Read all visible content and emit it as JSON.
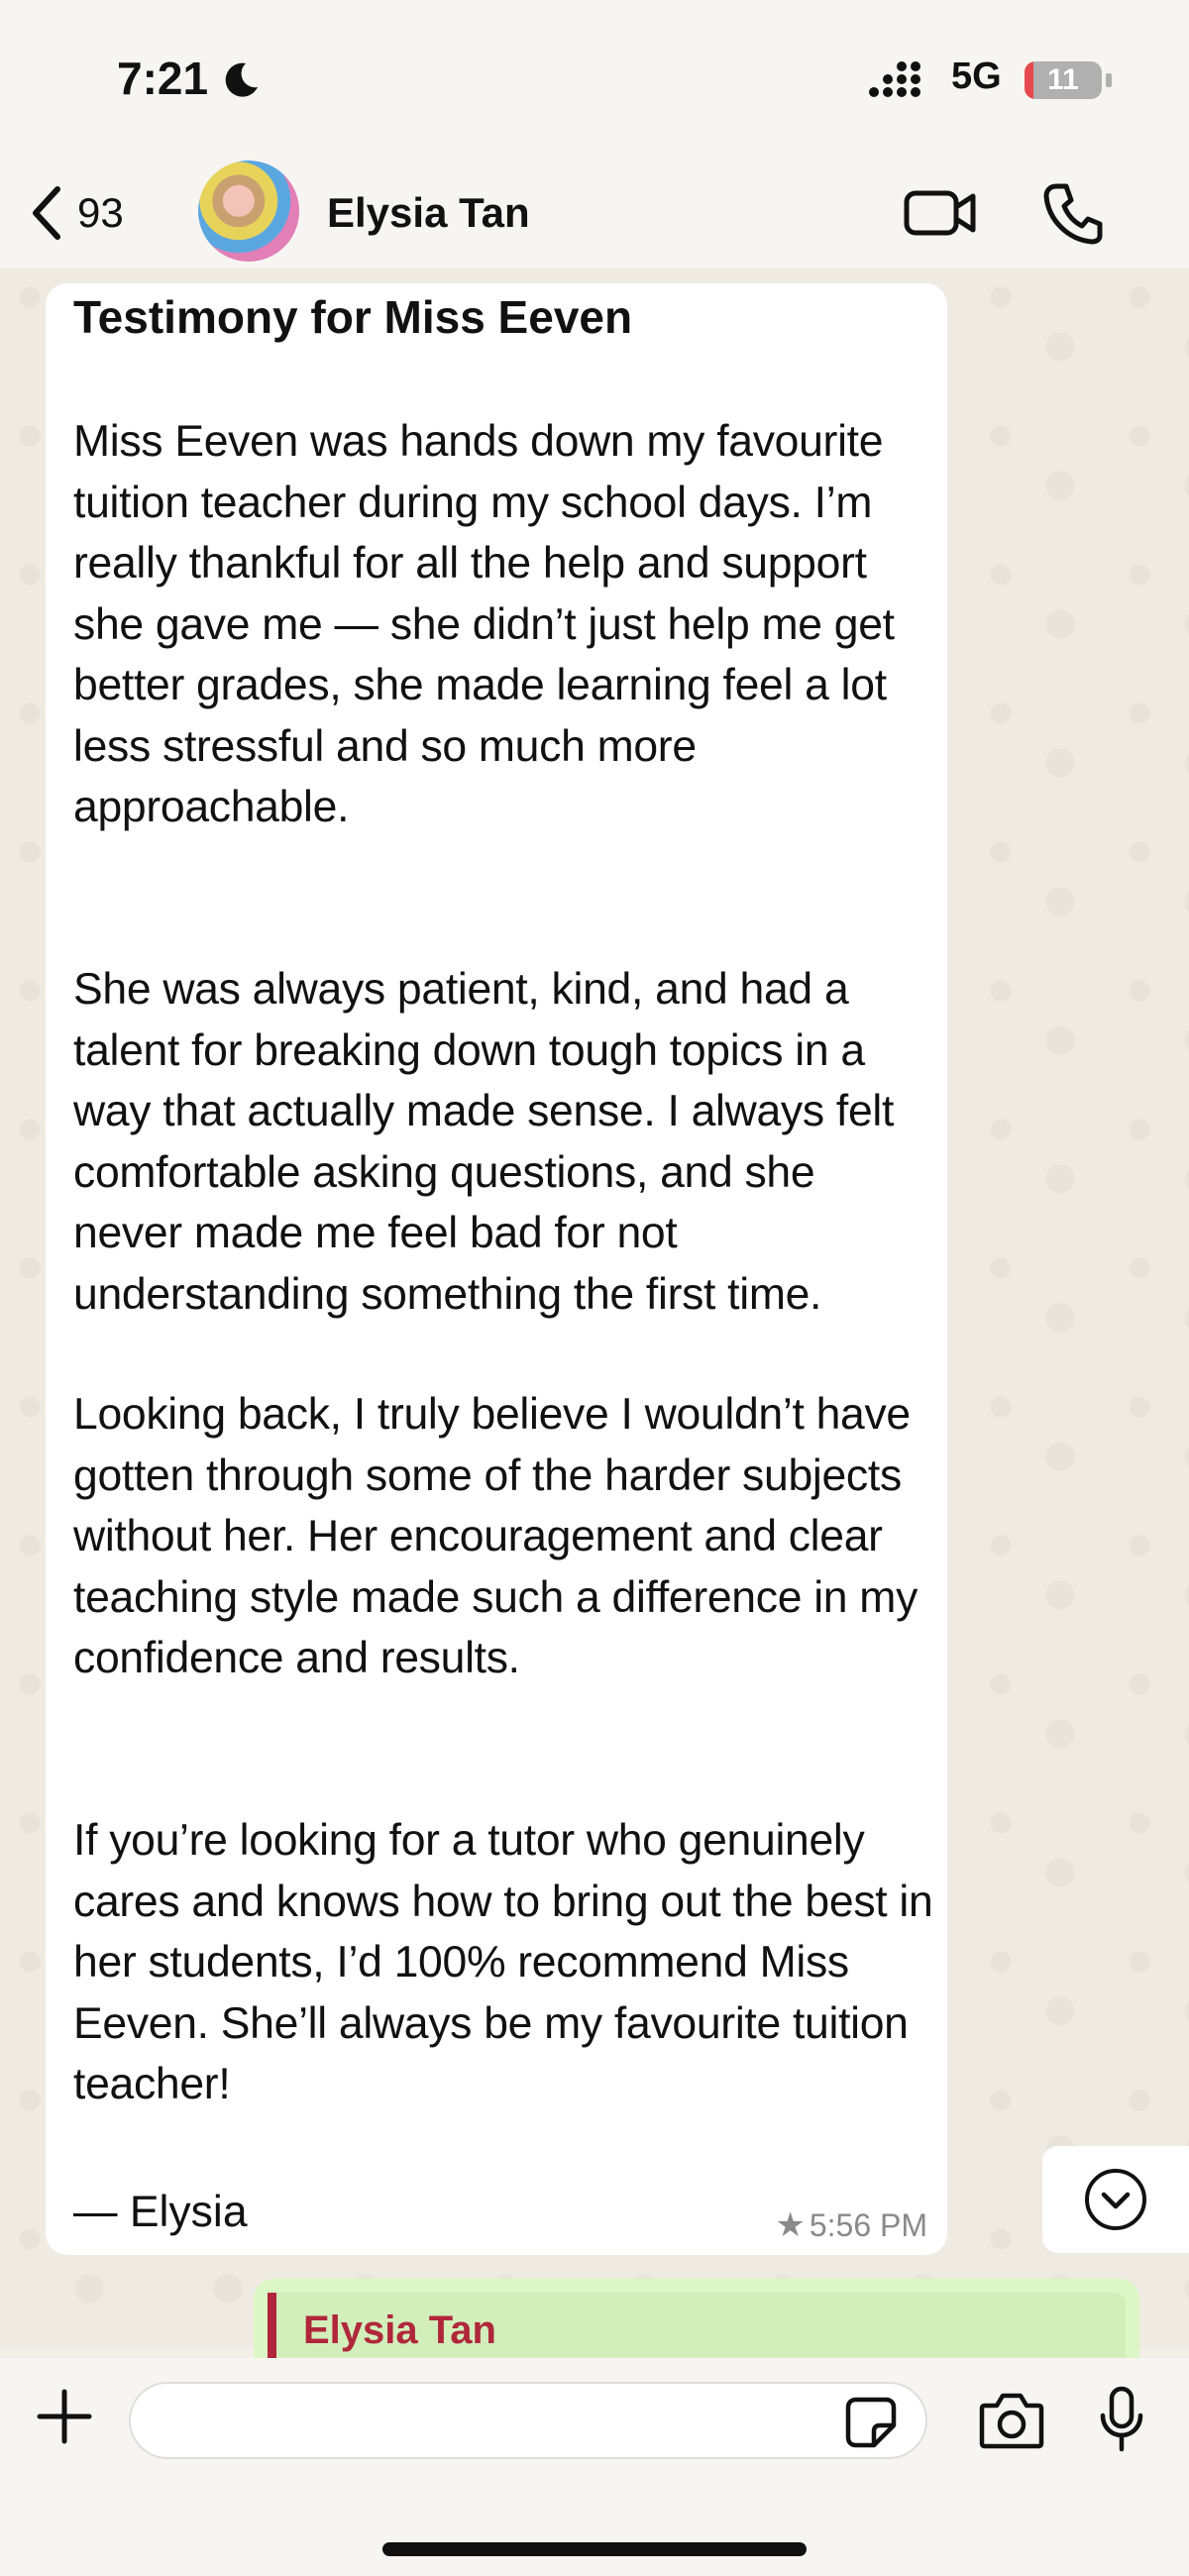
{
  "status_bar": {
    "time": "7:21",
    "network": "5G",
    "battery": "11",
    "battery_level_percent": 11
  },
  "header": {
    "back_count": "93",
    "contact_name": "Elysia Tan"
  },
  "message": {
    "title": "Testimony for Miss Eeven",
    "paragraphs": [
      "Miss Eeven was hands down my favourite tuition teacher during my school days. I’m really thankful for all the help and support she gave me — she didn’t just help me get better grades, she made learning feel a lot less stressful and so much more approachable.",
      "She was always patient, kind, and had a talent for breaking down tough topics in a way that actually made sense. I always felt comfortable asking questions, and she never made me feel bad for not understanding something the first time.",
      "Looking back, I truly believe I wouldn’t have gotten through some of the harder subjects without her. Her encouragement and clear teaching style made such a difference in my confidence and results.",
      "If you’re looking for a tutor who genuinely cares and knows how to bring out the best in her students, I’d 100% recommend Miss Eeven. She’ll always be my favourite tuition teacher!"
    ],
    "signature": "— Elysia",
    "timestamp": "5:56 PM",
    "starred": true
  },
  "next_message": {
    "quoted_author": "Elysia Tan"
  },
  "input": {
    "value": "",
    "placeholder": ""
  },
  "colors": {
    "wallpaper": "#efebe3",
    "bubble": "#ffffff",
    "reply_bubble": "#dcf7c5",
    "quote_accent": "#b0273b",
    "battery_low": "#e5484d"
  },
  "icons": [
    "moon-icon",
    "signal-icon",
    "back-chevron-icon",
    "video-call-icon",
    "phone-icon",
    "chevron-down-circle-icon",
    "plus-icon",
    "sticker-icon",
    "camera-icon",
    "microphone-icon",
    "star-icon"
  ]
}
